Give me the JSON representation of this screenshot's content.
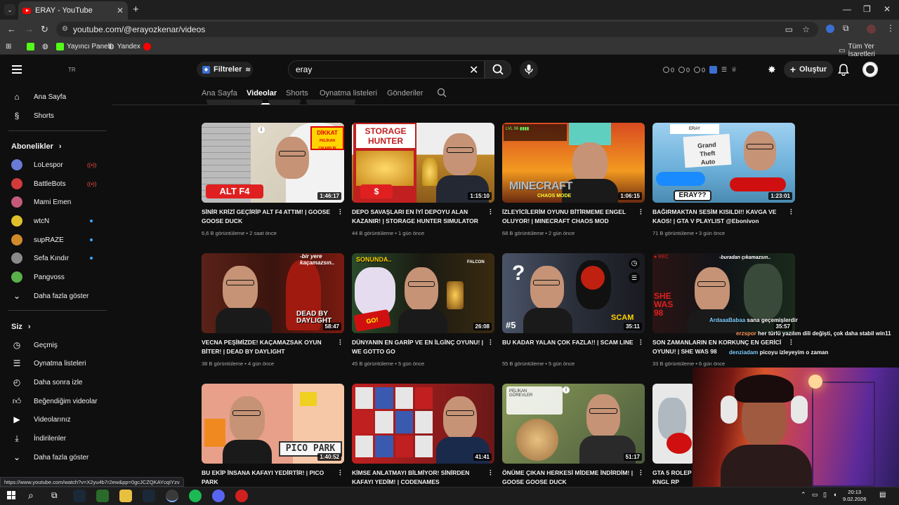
{
  "browser": {
    "tab_title": "ERAY - YouTube",
    "url": "youtube.com/@erayozkenar/videos",
    "bookmarks": [
      {
        "label": "Yayıncı Paneli"
      },
      {
        "label": "Yandex"
      }
    ],
    "all_bookmarks": "Tüm Yer İşaretleri"
  },
  "header": {
    "region": "TR",
    "filters_label": "Filtreler",
    "search_value": "eray",
    "stats": [
      "0",
      "0",
      "0"
    ],
    "create_label": "Oluştur"
  },
  "sidebar": {
    "top_items": [
      {
        "label": "Ana Sayfa",
        "icon": "home-icon"
      },
      {
        "label": "Shorts",
        "icon": "shorts-icon"
      }
    ],
    "subs_header": "Abonelikler",
    "channels": [
      {
        "label": "LoLespor",
        "status": "live",
        "color": "#6a7bd6"
      },
      {
        "label": "BattleBots",
        "status": "live",
        "color": "#d23b3b"
      },
      {
        "label": "Mami Emen",
        "status": "none",
        "color": "#c45a7a"
      },
      {
        "label": "wtcN",
        "status": "new",
        "color": "#e0c02a"
      },
      {
        "label": "supRAZE",
        "status": "new",
        "color": "#d08a2a"
      },
      {
        "label": "Sefa Kındır",
        "status": "new",
        "color": "#8a8a8a"
      },
      {
        "label": "Pangvoss",
        "status": "none",
        "color": "#5ab04b"
      }
    ],
    "show_more_subs": "Daha fazla göster",
    "you_header": "Siz",
    "you_items": [
      {
        "label": "Geçmiş",
        "icon": "history-icon"
      },
      {
        "label": "Oynatma listeleri",
        "icon": "playlists-icon"
      },
      {
        "label": "Daha sonra izle",
        "icon": "watch-later-icon"
      },
      {
        "label": "Beğendiğim videolar",
        "icon": "like-icon"
      },
      {
        "label": "Videolarınız",
        "icon": "your-videos-icon"
      },
      {
        "label": "İndirilenler",
        "icon": "downloads-icon"
      },
      {
        "label": "Daha fazla göster",
        "icon": "chevron-down-icon"
      }
    ]
  },
  "channel_tabs": [
    "Ana Sayfa",
    "Videolar",
    "Shorts",
    "Oynatma listeleri",
    "Gönderiler"
  ],
  "videos": [
    {
      "title": "SİNİR KRİZİ GEÇİRİP ALT F4 ATTIM! | GOOSE GOOSE DUCK",
      "views": "6,6 B görüntüleme",
      "age": "2 saat önce",
      "duration": "1:46:17",
      "overlay": "ALT F4",
      "bg": "#d9d2c4"
    },
    {
      "title": "DEPO SAVAŞLARI EN İYİ DEPOYU ALAN KAZANIR! | STORAGE HUNTER SIMULATOR",
      "views": "44 B görüntüleme",
      "age": "1 gün önce",
      "duration": "1:15:10",
      "overlay": "STORAGE HUNTER",
      "bg": "#b07a2a"
    },
    {
      "title": "İZLEYİCİLERİM OYUNU BİTİRMEME ENGEL OLUYOR! | MINECRAFT CHAOS MOD",
      "views": "68 B görüntüleme",
      "age": "2 gün önce",
      "duration": "1:06:15",
      "overlay": "MINECRAFT",
      "bg": "#c8502a"
    },
    {
      "title": "BAĞIRMAKTAN SESİM KISILDI!! KAVGA VE KAOS! | GTA V PLAYLIST @Ebonivon",
      "views": "71 B görüntüleme",
      "age": "3 gün önce",
      "duration": "1:23:01",
      "overlay": "ERAY??",
      "bg": "#7fb7e0"
    },
    {
      "title": "VECNA PEŞİMİZDE! KAÇAMAZSAK OYUN BİTER! | DEAD BY DAYLIGHT",
      "views": "38 B görüntüleme",
      "age": "4 gün önce",
      "duration": "58:47",
      "overlay": "DEAD BY DAYLIGHT",
      "bg": "#3a1a14"
    },
    {
      "title": "DÜNYANIN EN GARİP VE EN İLGİNÇ OYUNU! | WE GOTTO GO",
      "views": "45 B görüntüleme",
      "age": "5 gün önce",
      "duration": "26:08",
      "overlay": "SONUNDA..",
      "bg": "#2a2a1a"
    },
    {
      "title": "BU KADAR YALAN ÇOK FAZLA!! | SCAM LINE",
      "views": "55 B görüntüleme",
      "age": "5 gün önce",
      "duration": "35:11",
      "overlay": "#5",
      "bg": "#2a3140"
    },
    {
      "title": "SON ZAMANLARIN EN KORKUNÇ EN GERİCİ OYUNU! | SHE WAS 98",
      "views": "33 B görüntüleme",
      "age": "6 gün önce",
      "duration": "35:57",
      "overlay": "SHE WAS 98",
      "bg": "#161a1a"
    },
    {
      "title": "BU EKİP İNSANA KAFAYI YEDİRTİR! | PICO PARK",
      "views": "",
      "age": "",
      "duration": "1:40:52",
      "overlay": "PICO PARK",
      "bg": "#e8a08a"
    },
    {
      "title": "KİMSE ANLATMAYI BİLMİYOR! SİNİRDEN KAFAYI YEDİM! | CODENAMES",
      "views": "",
      "age": "",
      "duration": "41:41",
      "overlay": "",
      "bg": "#b02a2a"
    },
    {
      "title": "ÖNÜME ÇIKAN HERKESİ MİDEME İNDİRDİM! | GOOSE GOOSE DUCK",
      "views": "",
      "age": "",
      "duration": "51:17",
      "overlay": "",
      "bg": "#6a7a4a"
    },
    {
      "title": "GTA 5 ROLEP KNGL RP",
      "views": "",
      "age": "",
      "duration": "",
      "overlay": "",
      "bg": "#e8e8e8"
    }
  ],
  "chat": [
    {
      "user": "ArdaaaBabaa",
      "text": "sana geçemişlerdir"
    },
    {
      "user": "erzspor",
      "text": "her türlü yazılım dili değişti, çok daha stabil win11"
    },
    {
      "user": "denziadam",
      "text": "picoyu izleyeyim o zaman"
    }
  ],
  "status_url": "https://www.youtube.com/watch?v=X2yu4b7r2ew&pp=0gcJCZQKAYcqIYzv",
  "clock": {
    "time": "20:13",
    "date": "9.02.2026"
  }
}
